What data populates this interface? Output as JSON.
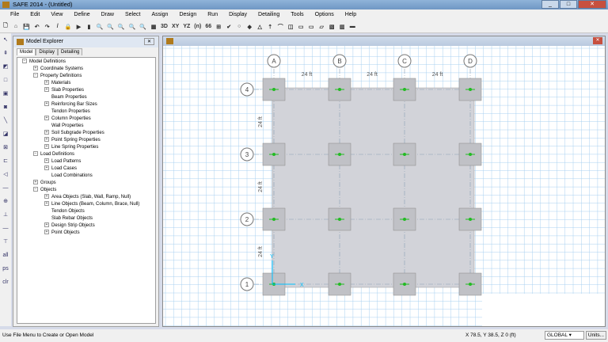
{
  "window": {
    "title": "SAFE 2014 - (Untitled)",
    "min": "_",
    "max": "□",
    "close": "✕"
  },
  "menu": [
    "File",
    "Edit",
    "View",
    "Define",
    "Draw",
    "Select",
    "Assign",
    "Design",
    "Run",
    "Display",
    "Detailing",
    "Tools",
    "Options",
    "Help"
  ],
  "toolbar": [
    "🗋",
    "⌂",
    "💾",
    "↶",
    "↷",
    "/",
    "🔒",
    "▶",
    "▮",
    "🔍",
    "🔍",
    "🔍",
    "🔍",
    "🔍",
    "▦",
    "3D",
    "XY",
    "YZ",
    "(n)",
    "66",
    "⊞",
    "✔",
    "○",
    "◆",
    "△",
    "⇡",
    "⌒",
    "◫",
    "▭",
    "▭",
    "▱",
    "▧",
    "▥",
    "▬"
  ],
  "left_tools": [
    "↖",
    "⇞",
    "◩",
    "□",
    "▣",
    "◙",
    "╲",
    "◪",
    "⊠",
    "⊏",
    "◁",
    "—",
    "⊕",
    "⊥",
    "—",
    "⊤",
    "all",
    "ps",
    "clr"
  ],
  "explorer": {
    "title": "Model Explorer",
    "close": "✕",
    "tabs": [
      "Model",
      "Display",
      "Detailing"
    ],
    "tree": [
      {
        "label": "Model Definitions",
        "level": 0,
        "toggle": "−"
      },
      {
        "label": "Coordinate Systems",
        "level": 1,
        "toggle": "+"
      },
      {
        "label": "Property Definitions",
        "level": 1,
        "toggle": "−"
      },
      {
        "label": "Materials",
        "level": 2,
        "toggle": "+"
      },
      {
        "label": "Slab Properties",
        "level": 2,
        "toggle": "+"
      },
      {
        "label": "Beam Properties",
        "level": 2,
        "toggle": ""
      },
      {
        "label": "Reinforcing Bar Sizes",
        "level": 2,
        "toggle": "+"
      },
      {
        "label": "Tendon Properties",
        "level": 2,
        "toggle": ""
      },
      {
        "label": "Column Properties",
        "level": 2,
        "toggle": "+"
      },
      {
        "label": "Wall Properties",
        "level": 2,
        "toggle": ""
      },
      {
        "label": "Soil Subgrade Properties",
        "level": 2,
        "toggle": "+"
      },
      {
        "label": "Point Spring Properties",
        "level": 2,
        "toggle": "+"
      },
      {
        "label": "Line Spring Properties",
        "level": 2,
        "toggle": "+"
      },
      {
        "label": "Load Definitions",
        "level": 1,
        "toggle": "−"
      },
      {
        "label": "Load Patterns",
        "level": 2,
        "toggle": "+"
      },
      {
        "label": "Load Cases",
        "level": 2,
        "toggle": "+"
      },
      {
        "label": "Load Combinations",
        "level": 2,
        "toggle": ""
      },
      {
        "label": "Groups",
        "level": 1,
        "toggle": "+"
      },
      {
        "label": "Objects",
        "level": 1,
        "toggle": "−"
      },
      {
        "label": "Area Objects (Slab, Wall, Ramp, Null)",
        "level": 2,
        "toggle": "+"
      },
      {
        "label": "Line Objects (Beam, Column, Brace, Null)",
        "level": 2,
        "toggle": "+"
      },
      {
        "label": "Tendon Objects",
        "level": 2,
        "toggle": ""
      },
      {
        "label": "Slab Rebar Objects",
        "level": 2,
        "toggle": ""
      },
      {
        "label": "Design Strip Objects",
        "level": 2,
        "toggle": "+"
      },
      {
        "label": "Point Objects",
        "level": 2,
        "toggle": "+"
      }
    ]
  },
  "plan": {
    "grid_x": [
      "A",
      "B",
      "C",
      "D"
    ],
    "grid_y": [
      "4",
      "3",
      "2",
      "1"
    ],
    "x_spacing": [
      "24 ft",
      "24 ft",
      "24 ft"
    ],
    "y_spacing": [
      "24 ft",
      "24 ft",
      "24 ft"
    ],
    "axis_x": "X",
    "axis_y": "Y",
    "colors": {
      "grid": "#a8d0f0",
      "slab": "#d2d3d9",
      "column": "#c0c1c6",
      "point": "#22bb22"
    }
  },
  "status": {
    "message": "Use File Menu to Create or Open Model",
    "coords": "X 78.5,  Y 38.5,  Z 0  (ft)",
    "coord_system": "GLOBAL",
    "units_button": "Units..."
  }
}
